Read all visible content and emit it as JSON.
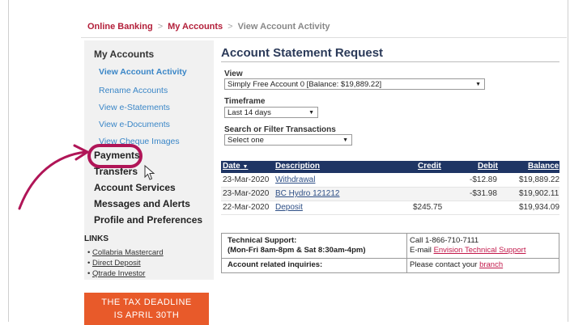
{
  "breadcrumb": {
    "home": "Online Banking",
    "section": "My Accounts",
    "current": "View Account Activity",
    "sep": ">"
  },
  "sidebar": {
    "title": "My Accounts",
    "sub_items": [
      "View Account Activity",
      "Rename Accounts",
      "View e-Statements",
      "View e-Documents",
      "View Cheque Images"
    ],
    "main_items": [
      "Payments",
      "Transfers",
      "Account Services",
      "Messages and Alerts",
      "Profile and Preferences"
    ],
    "links_heading": "LINKS",
    "links": [
      "Collabria Mastercard",
      "Direct Deposit",
      "Qtrade Investor"
    ],
    "banner_line1": "THE TAX DEADLINE",
    "banner_line2": "IS APRIL 30TH"
  },
  "main": {
    "title": "Account Statement Request",
    "view_label": "View",
    "view_value": "Simply Free Account 0 [Balance: $19,889.22]",
    "timeframe_label": "Timeframe",
    "timeframe_value": "Last 14 days",
    "filter_label": "Search or Filter Transactions",
    "filter_value": "Select one"
  },
  "table": {
    "headers": {
      "date": "Date",
      "description": "Description",
      "credit": "Credit",
      "debit": "Debit",
      "balance": "Balance"
    },
    "rows": [
      {
        "date": "23-Mar-2020",
        "description": "Withdrawal",
        "credit": "",
        "debit": "-$12.89",
        "balance": "$19,889.22"
      },
      {
        "date": "23-Mar-2020",
        "description": "BC Hydro 121212",
        "credit": "",
        "debit": "-$31.98",
        "balance": "$19,902.11"
      },
      {
        "date": "22-Mar-2020",
        "description": "Deposit",
        "credit": "$245.75",
        "debit": "",
        "balance": "$19,934.09"
      }
    ]
  },
  "support": {
    "tech_label1": "Technical Support:",
    "tech_label2": "(Mon-Fri 8am-8pm & Sat 8:30am-4pm)",
    "call": "Call 1-866-710-7111",
    "email_prefix": "E-mail ",
    "email_link": "Envision Technical Support",
    "inquiries_label": "Account related inquiries:",
    "contact_prefix": "Please contact your ",
    "contact_link": "branch"
  },
  "colors": {
    "accent": "#b31f3a",
    "nav_blue": "#3a86c7",
    "table_header": "#1f3564",
    "banner": "#e85a2a",
    "highlight": "#b01557"
  }
}
